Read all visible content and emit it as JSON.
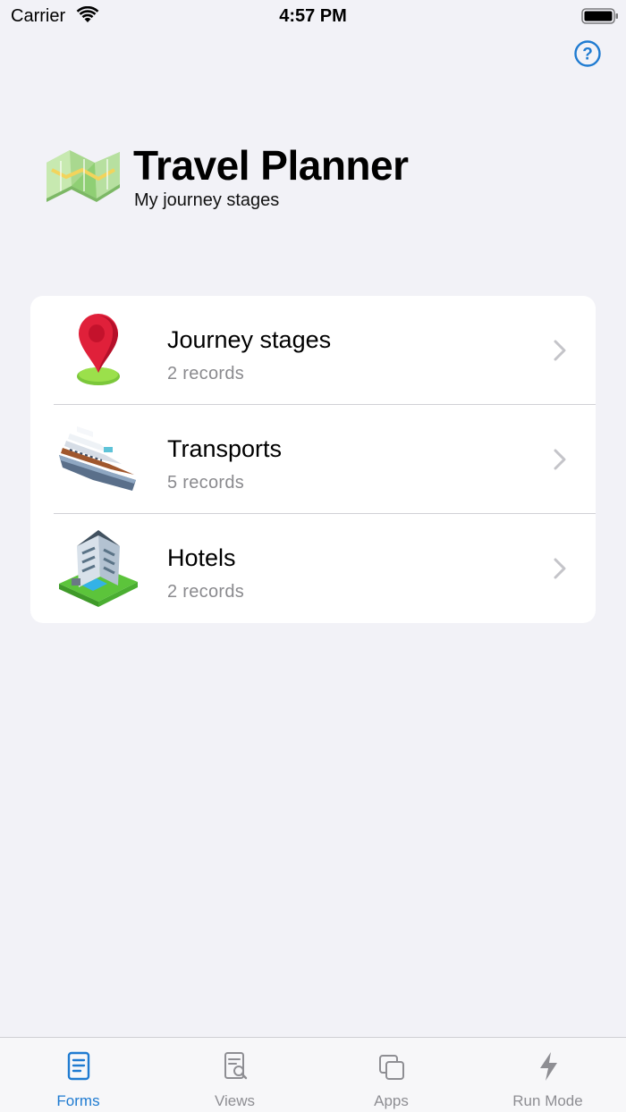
{
  "status_bar": {
    "carrier": "Carrier",
    "time": "4:57 PM"
  },
  "header": {
    "title": "Travel Planner",
    "subtitle": "My journey stages",
    "icon": "map-icon"
  },
  "help": {
    "icon": "help-icon",
    "label": "?"
  },
  "forms": [
    {
      "title": "Journey stages",
      "subtitle": "2 records",
      "icon": "location-pin-icon"
    },
    {
      "title": "Transports",
      "subtitle": "5 records",
      "icon": "ship-icon"
    },
    {
      "title": "Hotels",
      "subtitle": "2 records",
      "icon": "hotel-icon"
    }
  ],
  "tabs": [
    {
      "label": "Forms",
      "icon": "forms-icon",
      "active": true
    },
    {
      "label": "Views",
      "icon": "views-icon",
      "active": false
    },
    {
      "label": "Apps",
      "icon": "apps-icon",
      "active": false
    },
    {
      "label": "Run Mode",
      "icon": "bolt-icon",
      "active": false
    }
  ],
  "colors": {
    "accent": "#1f7bd1",
    "background": "#f2f2f7",
    "secondary_text": "#8a8a8e"
  }
}
